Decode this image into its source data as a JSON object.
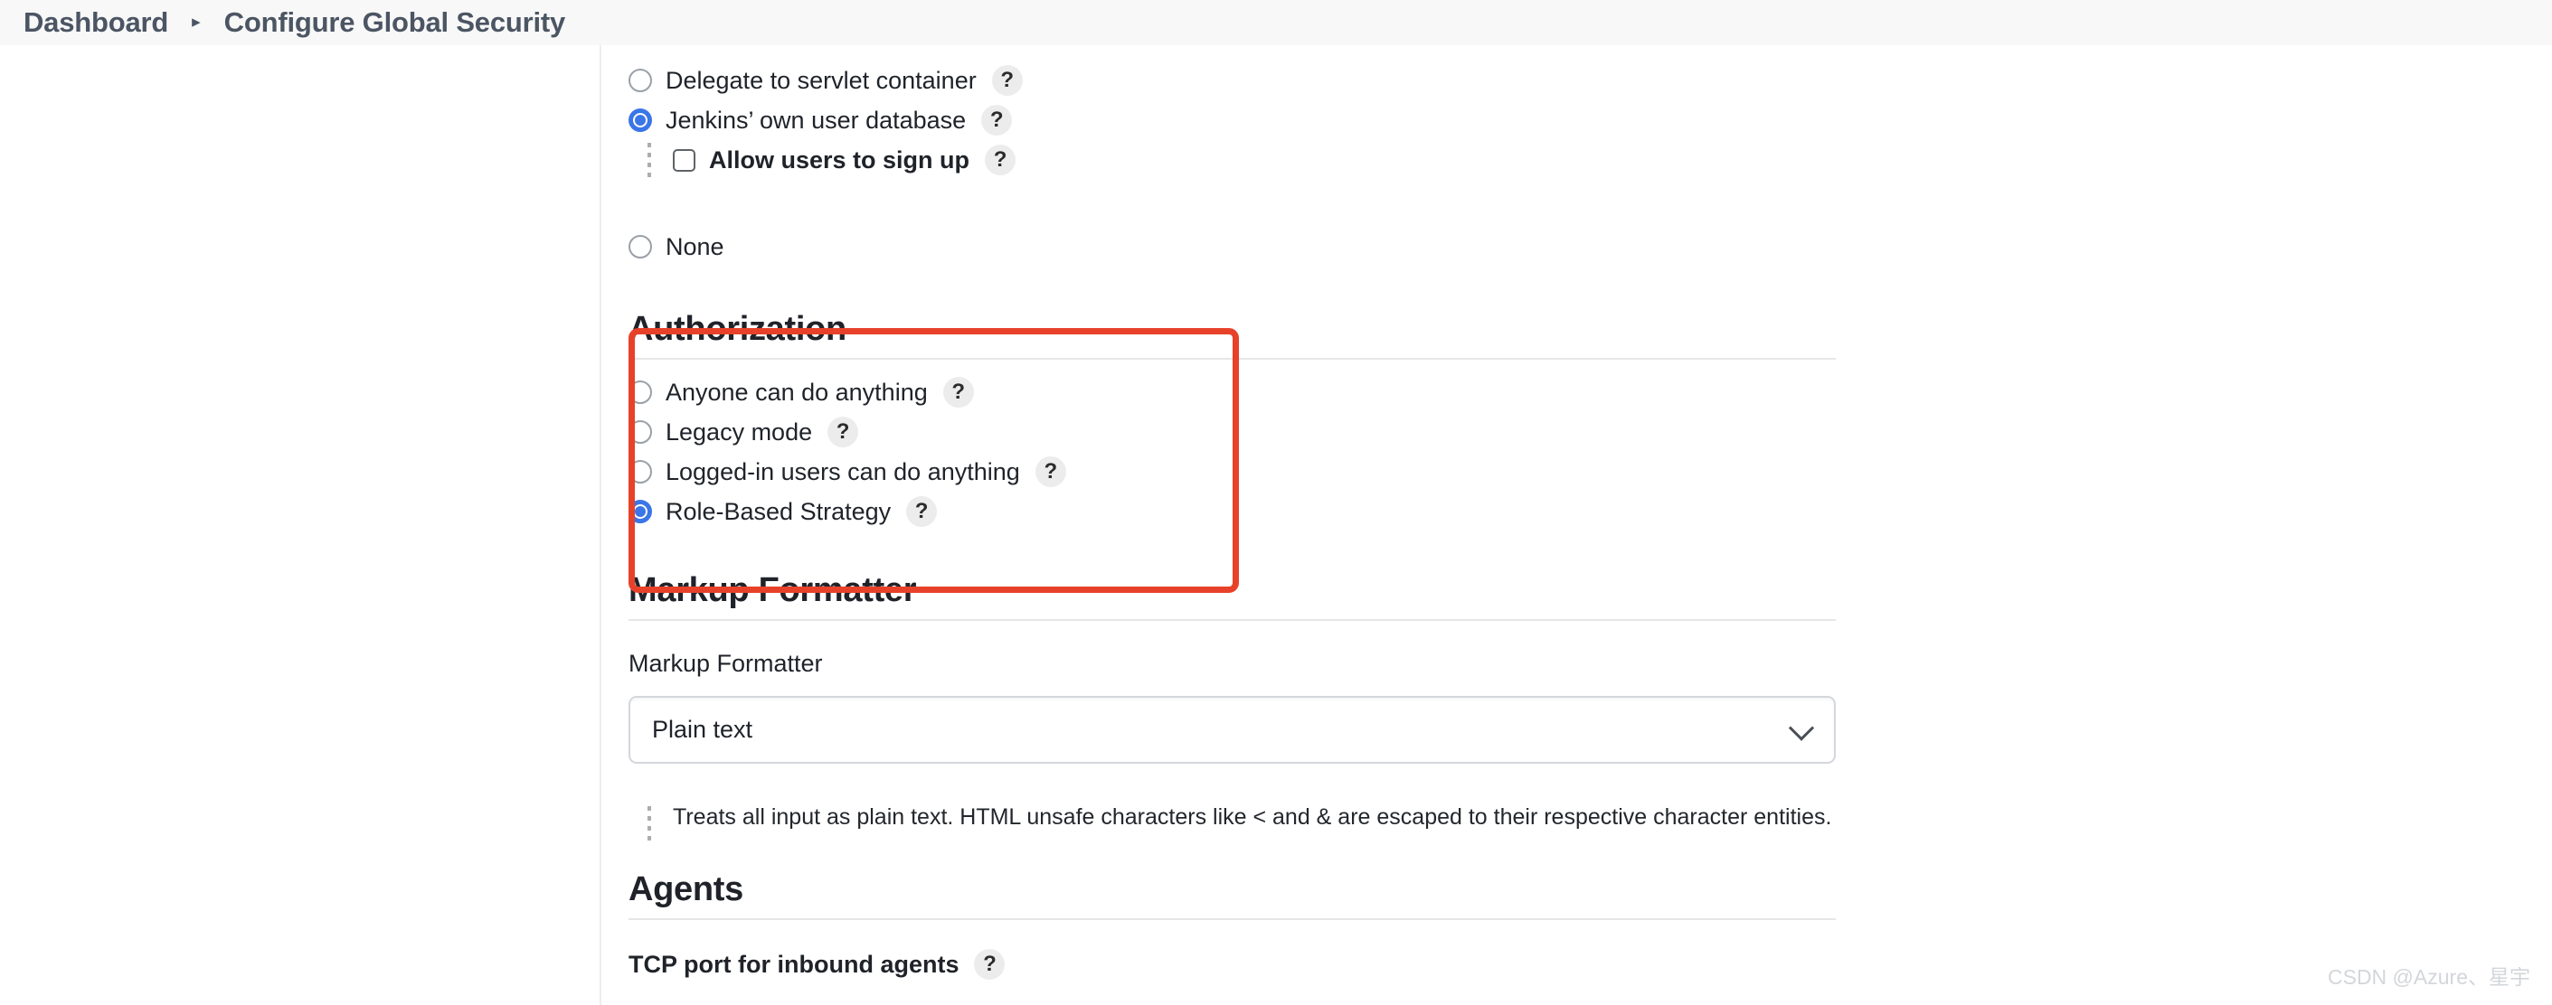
{
  "breadcrumb": {
    "items": [
      {
        "label": "Dashboard"
      },
      {
        "label": "Configure Global Security"
      }
    ],
    "separator": "▸"
  },
  "security_realm": {
    "options": [
      {
        "label": "Delegate to servlet container",
        "selected": false,
        "help": "?"
      },
      {
        "label": "Jenkins’ own user database",
        "selected": true,
        "help": "?"
      },
      {
        "label": "None",
        "selected": false,
        "help": ""
      }
    ],
    "sub_options": [
      {
        "label": "Allow users to sign up",
        "checked": false,
        "help": "?"
      }
    ]
  },
  "authorization": {
    "heading": "Authorization",
    "options": [
      {
        "label": "Anyone can do anything",
        "selected": false,
        "help": "?"
      },
      {
        "label": "Legacy mode",
        "selected": false,
        "help": "?"
      },
      {
        "label": "Logged-in users can do anything",
        "selected": false,
        "help": "?"
      },
      {
        "label": "Role-Based Strategy",
        "selected": true,
        "help": "?"
      }
    ],
    "highlight_color": "#e8412a"
  },
  "markup_formatter": {
    "heading": "Markup Formatter",
    "field_label": "Markup Formatter",
    "selected_value": "Plain text",
    "options": [
      "Plain text"
    ],
    "description": "Treats all input as plain text. HTML unsafe characters like < and & are escaped to their respective character entities."
  },
  "agents": {
    "heading": "Agents",
    "field_label": "TCP port for inbound agents",
    "help": "?"
  },
  "watermark": {
    "text": "CSDN @Azure、星宇"
  }
}
